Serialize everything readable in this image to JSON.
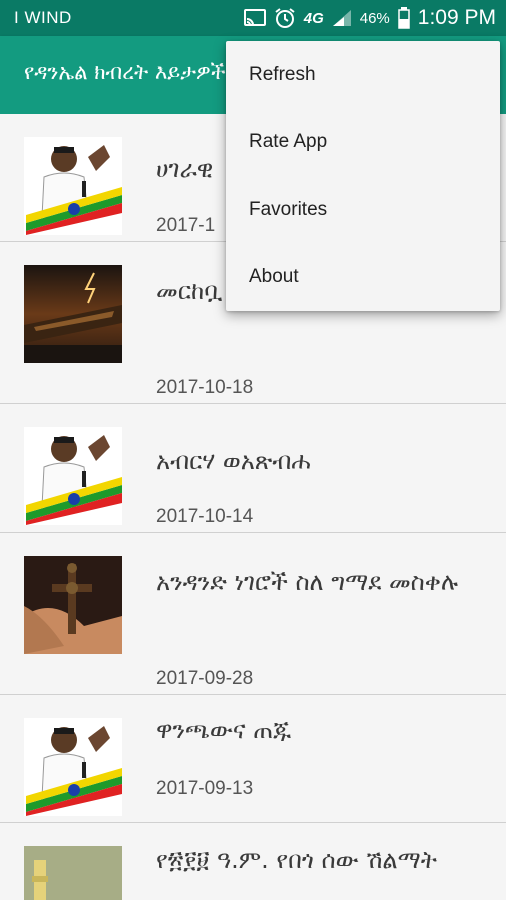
{
  "status_bar": {
    "carrier": "I WIND",
    "network": "4G",
    "battery_percent": "46%",
    "time": "1:09 PM",
    "icons": [
      "cast-icon",
      "alarm-icon",
      "signal-icon",
      "battery-icon"
    ]
  },
  "app_bar": {
    "title": "የዳንኤል ክብረት እይታዎች"
  },
  "overflow_menu": {
    "items": [
      {
        "label": "Refresh"
      },
      {
        "label": "Rate App"
      },
      {
        "label": "Favorites"
      },
      {
        "label": "About"
      }
    ]
  },
  "articles": [
    {
      "title": "ሀገራዊ",
      "date": "2017-1",
      "thumb": "portrait-flag"
    },
    {
      "title": "መርከቧ በመርከቧ ላይ?",
      "date": "2017-10-18",
      "thumb": "ark-storm"
    },
    {
      "title": "አብርሃ ወአጽብሐ",
      "date": "2017-10-14",
      "thumb": "portrait-flag"
    },
    {
      "title": "አንዳንድ ነገሮች ስለ ግማደ መስቀሉ",
      "date": "2017-09-28",
      "thumb": "cross-hands"
    },
    {
      "title": "ዋንጫውና ጠጁ",
      "date": "2017-09-13",
      "thumb": "portrait-flag"
    },
    {
      "title": "የ፳፻፱ ዓ.ም. የበጎ ሰው ሽልማት",
      "date": "",
      "thumb": "text-poster"
    }
  ],
  "colors": {
    "status_bar": "#0a7a65",
    "app_bar": "#139b80",
    "list_bg": "#f5f5f5",
    "menu_bg": "#f4f4f4"
  }
}
